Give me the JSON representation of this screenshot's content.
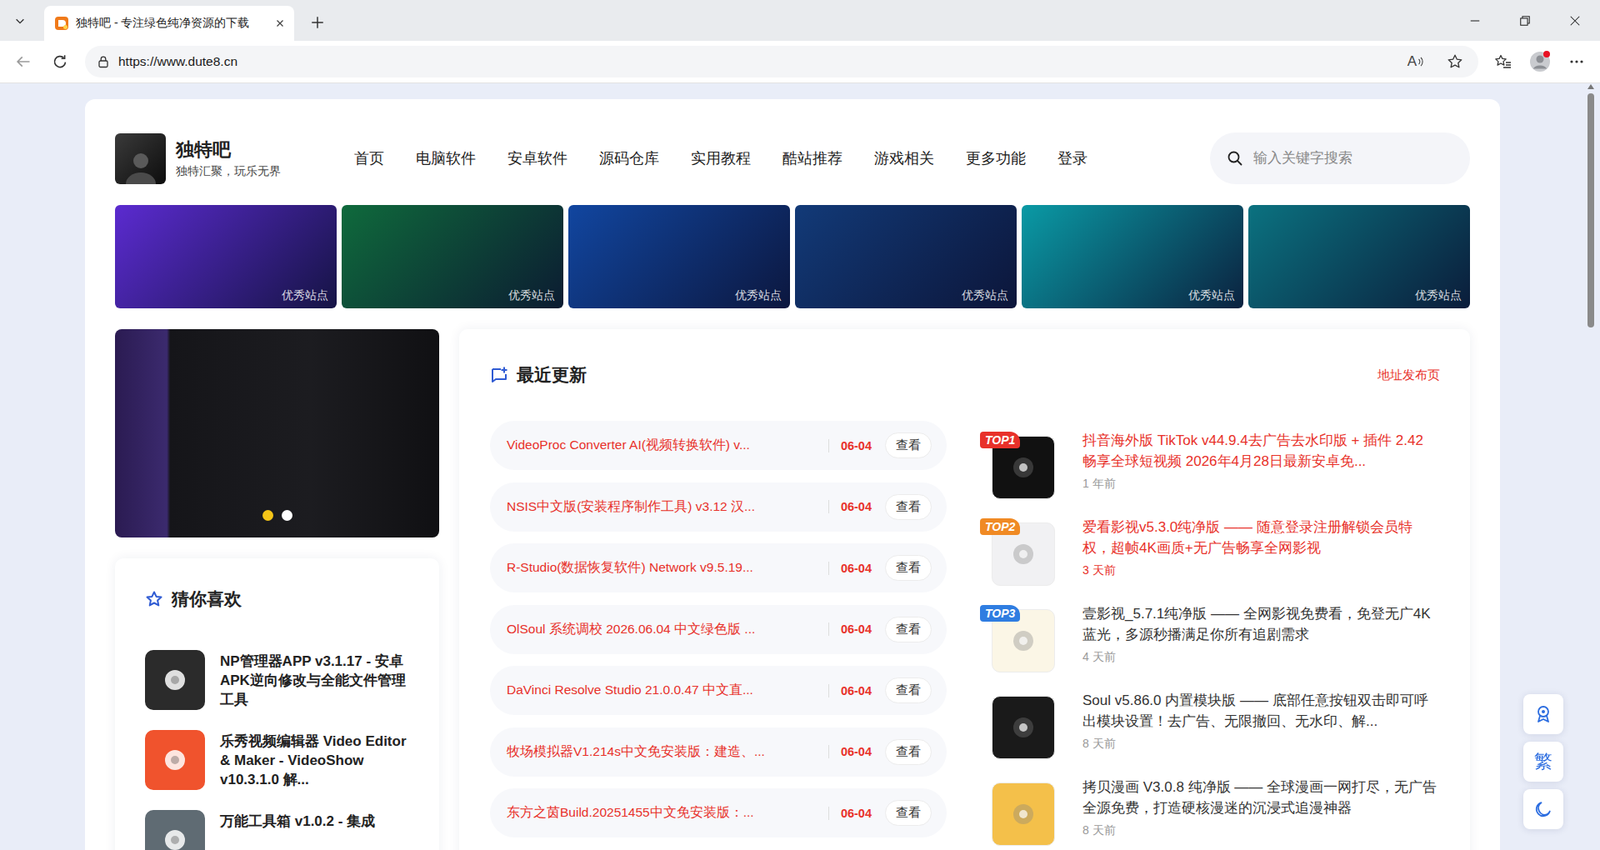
{
  "browser": {
    "tab": {
      "title": "独特吧 - 专注绿色纯净资源的下载",
      "selected": true
    },
    "address": "https://www.dute8.cn",
    "read_aloud_icon": "A",
    "profile": {
      "notification": true
    }
  },
  "site": {
    "brand": {
      "name": "独特吧",
      "slogan": "独特汇聚，玩乐无界"
    },
    "nav": [
      {
        "label": "首页",
        "selected": false
      },
      {
        "label": "电脑软件",
        "selected": false
      },
      {
        "label": "安卓软件",
        "selected": false
      },
      {
        "label": "源码仓库",
        "selected": false
      },
      {
        "label": "实用教程",
        "selected": false
      },
      {
        "label": "酷站推荐",
        "selected": false
      },
      {
        "label": "游戏相关",
        "selected": false
      },
      {
        "label": "更多功能",
        "selected": false
      },
      {
        "label": "登录",
        "selected": false
      }
    ],
    "search": {
      "placeholder": "输入关键字搜索"
    }
  },
  "banners": [
    {
      "badge": "优秀站点",
      "color": "#5b2bd0"
    },
    {
      "badge": "优秀站点",
      "color": "#0f6a3c"
    },
    {
      "badge": "优秀站点",
      "color": "#1146a0"
    },
    {
      "badge": "优秀站点",
      "color": "#123a78"
    },
    {
      "badge": "优秀站点",
      "color": "#0a9aa5"
    },
    {
      "badge": "优秀站点",
      "color": "#0b7280"
    }
  ],
  "slider": {
    "dots": [
      {
        "selected": true
      },
      {
        "selected": false
      }
    ]
  },
  "guess": {
    "title": "猜你喜欢",
    "items": [
      {
        "title": "NP管理器APP v3.1.17 - 安卓APK逆向修改与全能文件管理工具",
        "color": "#2b2b2b"
      },
      {
        "title": "乐秀视频编辑器 Video Editor & Maker - VideoShow v10.3.1.0 解...",
        "color": "#f0532d"
      },
      {
        "title": "万能工具箱 v1.0.2 - 集成",
        "color": "#5f6b73"
      }
    ]
  },
  "recent": {
    "title": "最近更新",
    "link": "地址发布页",
    "rows": [
      {
        "title": "VideoProc Converter AI(视频转换软件) v...",
        "date": "06-04",
        "action": "查看"
      },
      {
        "title": "NSIS中文版(安装程序制作工具) v3.12 汉...",
        "date": "06-04",
        "action": "查看"
      },
      {
        "title": "R-Studio(数据恢复软件) Network v9.5.19...",
        "date": "06-04",
        "action": "查看"
      },
      {
        "title": "OlSoul 系统调校 2026.06.04 中文绿色版 ...",
        "date": "06-04",
        "action": "查看"
      },
      {
        "title": "DaVinci Resolve Studio 21.0.0.47 中文直...",
        "date": "06-04",
        "action": "查看"
      },
      {
        "title": "牧场模拟器V1.214s中文免安装版：建造、...",
        "date": "06-04",
        "action": "查看"
      },
      {
        "title": "东方之茵Build.20251455中文免安装版：...",
        "date": "06-04",
        "action": "查看"
      }
    ],
    "top": [
      {
        "rank": "TOP1",
        "rank_color": "#e8312a",
        "title": "抖音海外版 TikTok v44.9.4去广告去水印版 + 插件 2.42 畅享全球短视频 2026年4月28日最新安卓免...",
        "title_color": "#e8312a",
        "time": "1 年前",
        "time_color": "#999999",
        "icon_color": "#111111"
      },
      {
        "rank": "TOP2",
        "rank_color": "#f08a24",
        "title": "爱看影视v5.3.0纯净版 —— 随意登录注册解锁会员特权，超帧4K画质+无广告畅享全网影视",
        "title_color": "#e8312a",
        "time": "3 天前",
        "time_color": "#e8312a",
        "icon_color": "#f1f1f3"
      },
      {
        "rank": "TOP3",
        "rank_color": "#2f7de1",
        "title": "壹影视_5.7.1纯净版 —— 全网影视免费看，免登无广4K蓝光，多源秒播满足你所有追剧需求",
        "title_color": "#333333",
        "time": "4 天前",
        "time_color": "#999999",
        "icon_color": "#fbf6e6"
      },
      {
        "title": "Soul v5.86.0 内置模块版 —— 底部任意按钮双击即可呼出模块设置！去广告、无限撤回、无水印、解...",
        "title_color": "#333333",
        "time": "8 天前",
        "time_color": "#999999",
        "icon_color": "#1a1a1a"
      },
      {
        "title": "拷贝漫画 V3.0.8 纯净版 —— 全球漫画一网打尽，无广告全源免费，打造硬核漫迷的沉浸式追漫神器",
        "title_color": "#333333",
        "time": "8 天前",
        "time_color": "#999999",
        "icon_color": "#f4c04a"
      }
    ]
  },
  "float_tools": {
    "lang": "繁"
  },
  "scrollbar": {
    "level": 0.31
  }
}
